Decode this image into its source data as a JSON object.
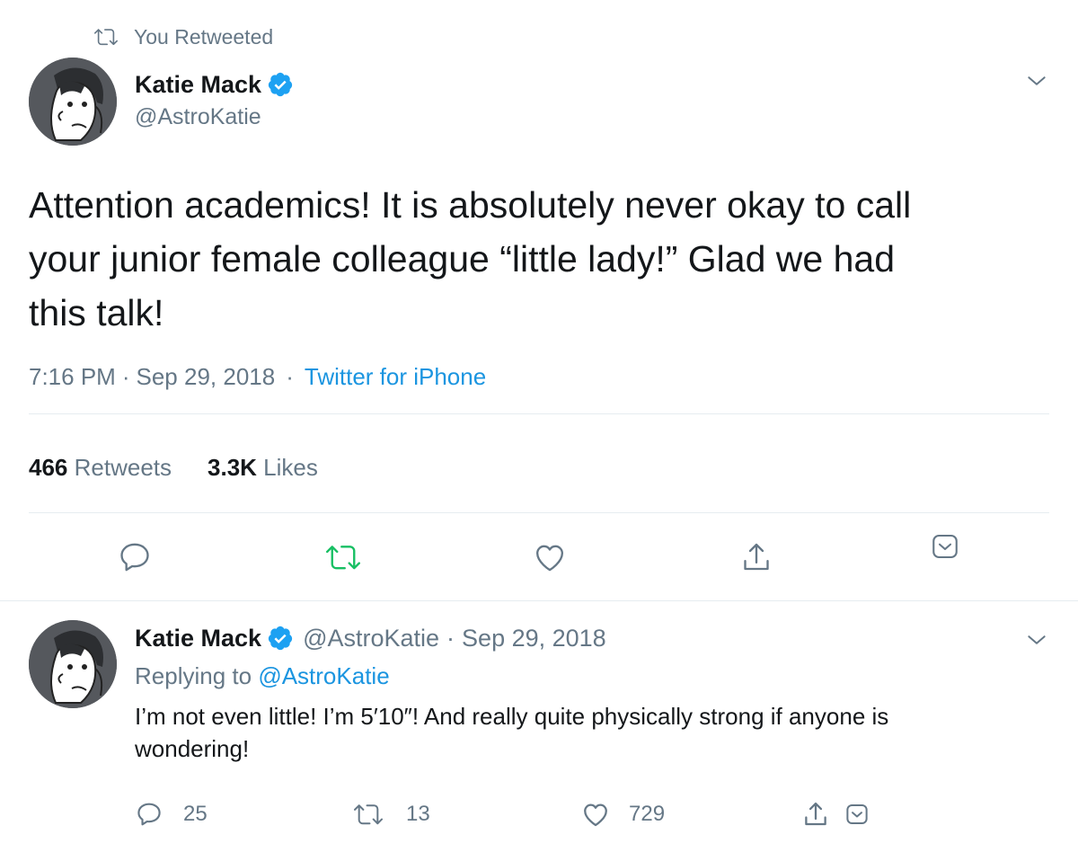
{
  "colors": {
    "text": "#14171a",
    "secondary": "#657786",
    "link": "#1b95e0",
    "retweet_active": "#17bf63",
    "divider": "#e6ecf0"
  },
  "context": {
    "icon": "retweet-icon",
    "label": "You Retweeted"
  },
  "main_tweet": {
    "author_name": "Katie Mack",
    "author_handle": "@AstroKatie",
    "verified": true,
    "text_lines": [
      "Attention academics! It is absolutely never okay to call",
      "your junior female colleague “little lady!” Glad we had",
      "this talk!"
    ],
    "time": "7:16 PM",
    "separator": "·",
    "date": "Sep 29, 2018",
    "source": "Twitter for iPhone",
    "retweets_count": "466",
    "retweets_label": "Retweets",
    "likes_count": "3.3K",
    "likes_label": "Likes",
    "actions": [
      "reply-icon",
      "retweet-icon",
      "like-icon",
      "share-icon",
      "dm-icon"
    ]
  },
  "reply_tweet": {
    "author_name": "Katie Mack",
    "author_handle": "@AstroKatie",
    "separator": "·",
    "date": "Sep 29, 2018",
    "replying_prefix": "Replying to",
    "replying_to": "@AstroKatie",
    "text_lines": [
      "I’m not even little! I’m 5′10″! And really quite physically strong if anyone is",
      "wondering!"
    ],
    "reply_count": "25",
    "retweet_count": "13",
    "like_count": "729"
  }
}
